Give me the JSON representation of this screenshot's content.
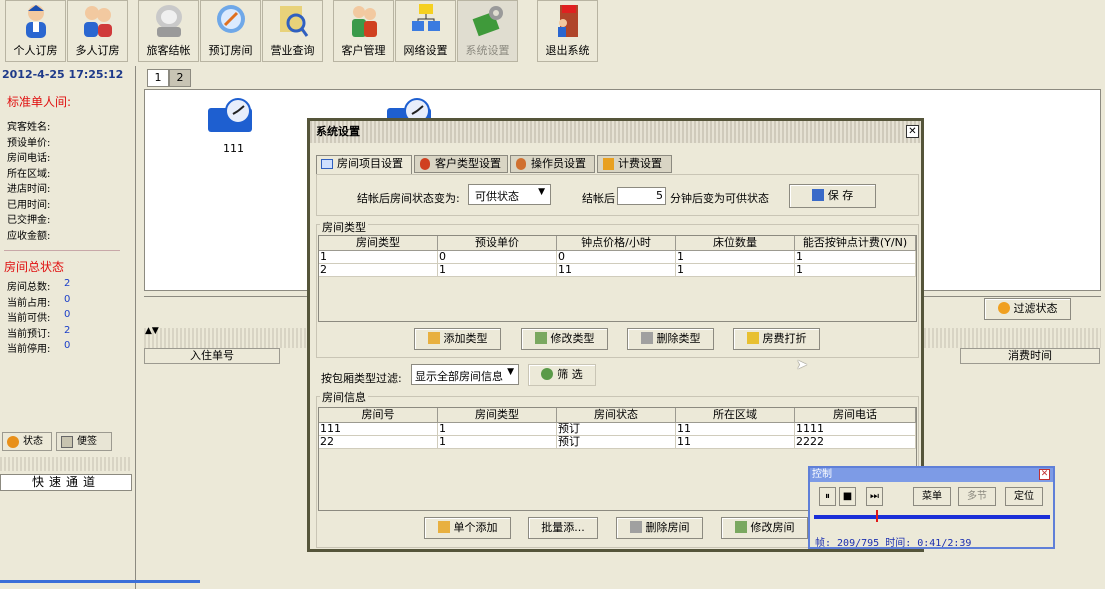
{
  "toolbar": {
    "buttons": [
      {
        "label": "个人订房",
        "icon": "single-booking-icon"
      },
      {
        "label": "多人订房",
        "icon": "group-booking-icon"
      },
      {
        "label": "旅客结帐",
        "icon": "checkout-icon"
      },
      {
        "label": "预订房间",
        "icon": "reserve-room-icon"
      },
      {
        "label": "营业查询",
        "icon": "business-query-icon"
      },
      {
        "label": "客户管理",
        "icon": "customer-management-icon"
      },
      {
        "label": "网络设置",
        "icon": "network-settings-icon"
      },
      {
        "label": "系统设置",
        "icon": "system-settings-icon"
      },
      {
        "label": "退出系统",
        "icon": "exit-icon"
      }
    ]
  },
  "left_panel": {
    "datetime": "2012-4-25 17:25:12",
    "room_title": "标准单人间:",
    "fields": [
      "宾客姓名:",
      "预设单价:",
      "房间电话:",
      "所在区域:",
      "进店时间:",
      "已用时间:",
      "已交押金:",
      "应收金额:"
    ],
    "status_title": "房间总状态",
    "status": [
      {
        "label": "房间总数:",
        "value": "2"
      },
      {
        "label": "当前占用:",
        "value": "0"
      },
      {
        "label": "当前可供:",
        "value": "0"
      },
      {
        "label": "当前预订:",
        "value": "2"
      },
      {
        "label": "当前停用:",
        "value": "0"
      }
    ],
    "tabs": [
      "状态",
      "便签"
    ],
    "quick_channel": "快速通道"
  },
  "page_tabs": [
    "1",
    "2"
  ],
  "rooms": [
    {
      "number": "111"
    }
  ],
  "bottom_headers": {
    "checkin_no": "入住单号",
    "consume_time": "消费时间"
  },
  "filter_status_btn": "过滤状态",
  "dialog": {
    "title": "系统设置",
    "tabs": [
      "房间项目设置",
      "客户类型设置",
      "操作员设置",
      "计费设置"
    ],
    "checkout_status_label": "结帐后房间状态变为:",
    "checkout_status_value": "可供状态",
    "after_label": "结帐后",
    "minutes_value": "5",
    "minutes_suffix": "分钟后变为可供状态",
    "save_label": "保 存",
    "room_type_group": "房间类型",
    "room_type_headers": [
      "房间类型",
      "预设单价",
      "钟点价格/小时",
      "床位数量",
      "能否按钟点计费(Y/N)"
    ],
    "room_type_rows": [
      [
        "1",
        "0",
        "0",
        "1",
        "1"
      ],
      [
        "2",
        "1",
        "11",
        "1",
        "1"
      ]
    ],
    "room_type_buttons": [
      "添加类型",
      "修改类型",
      "删除类型",
      "房费打折"
    ],
    "filter_label": "按包厢类型过滤:",
    "filter_value": "显示全部房间信息",
    "filter_btn": "筛 选",
    "room_info_group": "房间信息",
    "room_info_headers": [
      "房间号",
      "房间类型",
      "房间状态",
      "所在区域",
      "房间电话"
    ],
    "room_info_rows": [
      [
        "111",
        "1",
        "预订",
        "11",
        "1111"
      ],
      [
        "22",
        "1",
        "预订",
        "11",
        "2222"
      ]
    ],
    "room_info_buttons": [
      "单个添加",
      "批量添...",
      "删除房间",
      "修改房间"
    ]
  },
  "control": {
    "title": "控制",
    "menu_btn": "菜单",
    "multi_btn": "多节",
    "locate_btn": "定位",
    "status": "帧: 209/795 时间: 0:41/2:39",
    "progress": 0.263
  }
}
